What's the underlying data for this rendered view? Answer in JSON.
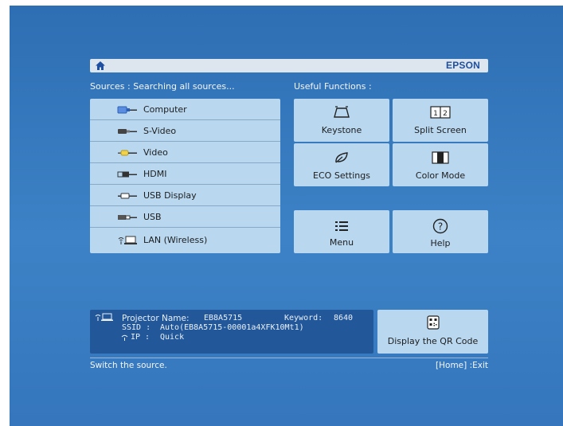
{
  "header": {
    "brand": "EPSON"
  },
  "sources": {
    "heading": "Sources : Searching all sources...",
    "items": [
      {
        "label": "Computer",
        "icon": "computer-port-icon"
      },
      {
        "label": "S-Video",
        "icon": "svideo-port-icon"
      },
      {
        "label": "Video",
        "icon": "video-port-icon"
      },
      {
        "label": "HDMI",
        "icon": "hdmi-port-icon"
      },
      {
        "label": "USB Display",
        "icon": "usb-display-port-icon"
      },
      {
        "label": "USB",
        "icon": "usb-port-icon"
      },
      {
        "label": "LAN (Wireless)",
        "icon": "wireless-lan-icon"
      }
    ]
  },
  "functions": {
    "heading": "Useful Functions :",
    "keystone": "Keystone",
    "split_screen": "Split Screen",
    "split_icon_text": "1 2",
    "eco_settings": "ECO Settings",
    "color_mode": "Color Mode",
    "menu": "Menu",
    "help": "Help"
  },
  "network": {
    "projector_name_label": "Projector Name:",
    "projector_name_value": "EB8A5715",
    "keyword_label": "Keyword:",
    "keyword_value": "8640",
    "ssid_label": "SSID :",
    "ssid_value": "Auto(EB8A5715-00001a4XFK10Mt1)",
    "ip_label": "IP :",
    "ip_value": "Quick"
  },
  "qr": {
    "label": "Display the QR Code"
  },
  "status_bar": {
    "hint": "Switch the source.",
    "exit_hint": "[Home] :Exit"
  },
  "colors": {
    "background": "#3d82c6",
    "tile": "#b9d8f0",
    "info_panel": "#22589a",
    "brand": "#1f4fa0"
  }
}
